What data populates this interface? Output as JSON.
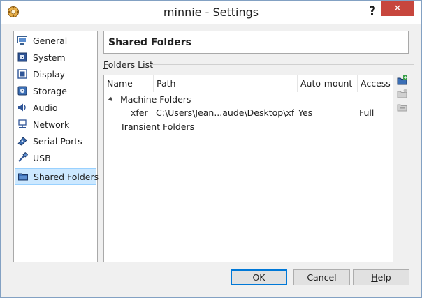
{
  "window": {
    "title": "minnie - Settings",
    "help_glyph": "?",
    "close_glyph": "✕"
  },
  "sidebar": {
    "items": [
      {
        "label": "General",
        "icon": "general-icon",
        "selected": false
      },
      {
        "label": "System",
        "icon": "system-icon",
        "selected": false
      },
      {
        "label": "Display",
        "icon": "display-icon",
        "selected": false
      },
      {
        "label": "Storage",
        "icon": "storage-icon",
        "selected": false
      },
      {
        "label": "Audio",
        "icon": "audio-icon",
        "selected": false
      },
      {
        "label": "Network",
        "icon": "network-icon",
        "selected": false
      },
      {
        "label": "Serial Ports",
        "icon": "serial-ports-icon",
        "selected": false
      },
      {
        "label": "USB",
        "icon": "usb-icon",
        "selected": false
      },
      {
        "label": "Shared Folders",
        "icon": "shared-folders-icon",
        "selected": true
      }
    ]
  },
  "main": {
    "page_title": "Shared Folders",
    "group_label_accel": "F",
    "group_label_rest": "olders List",
    "table": {
      "columns": [
        "Name",
        "Path",
        "Auto-mount",
        "Access"
      ],
      "groups": [
        {
          "label": "Machine Folders",
          "expanded": true,
          "rows": [
            {
              "name": "xfer",
              "path": "C:\\Users\\Jean...aude\\Desktop\\xfer",
              "auto_mount": "Yes",
              "access": "Full"
            }
          ]
        },
        {
          "label": "Transient Folders",
          "expanded": false,
          "rows": []
        }
      ]
    }
  },
  "buttons": {
    "ok": "OK",
    "cancel": "Cancel",
    "help_accel": "H",
    "help_rest": "elp"
  },
  "colors": {
    "accent": "#0078d7",
    "selection_bg": "#cce8ff",
    "close_bg": "#c7463d"
  }
}
